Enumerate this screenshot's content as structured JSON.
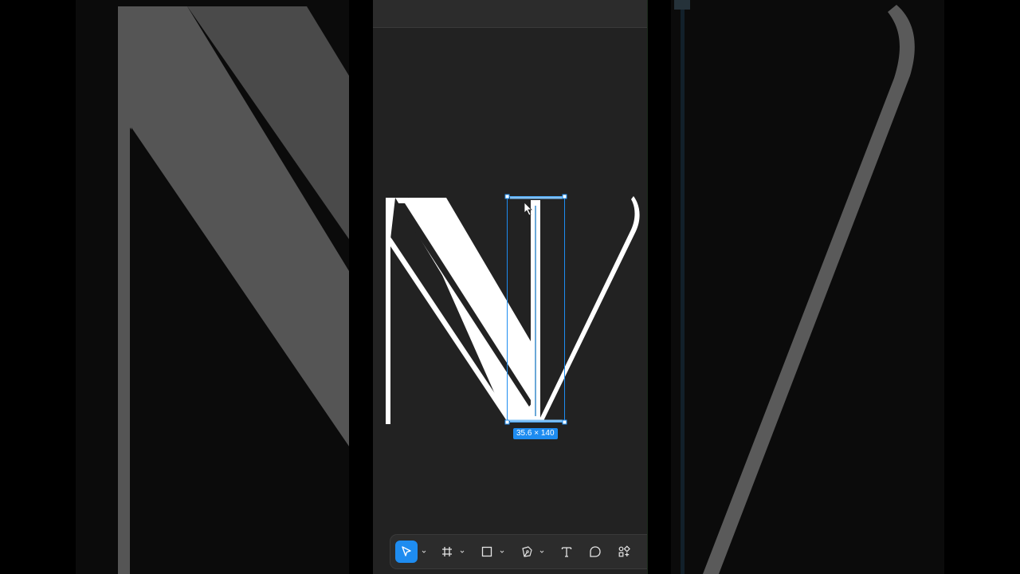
{
  "selection": {
    "dimensions_label": "35.6 × 140"
  },
  "toolbar": {
    "tools": [
      {
        "name": "move",
        "icon": "cursor-arrow-icon",
        "active": true
      },
      {
        "name": "frame",
        "icon": "frame-hash-icon",
        "active": false
      },
      {
        "name": "shape",
        "icon": "rectangle-icon",
        "active": false
      },
      {
        "name": "pen",
        "icon": "pen-nib-icon",
        "active": false
      },
      {
        "name": "text",
        "icon": "text-t-icon",
        "active": false
      },
      {
        "name": "comment",
        "icon": "comment-bubble-icon",
        "active": false
      },
      {
        "name": "resources",
        "icon": "components-grid-icon",
        "active": false
      }
    ]
  },
  "colors": {
    "canvas": "#222222",
    "accent": "#1e8cf0",
    "glyph": "#ffffff",
    "toolbar": "#2c2c2c"
  }
}
